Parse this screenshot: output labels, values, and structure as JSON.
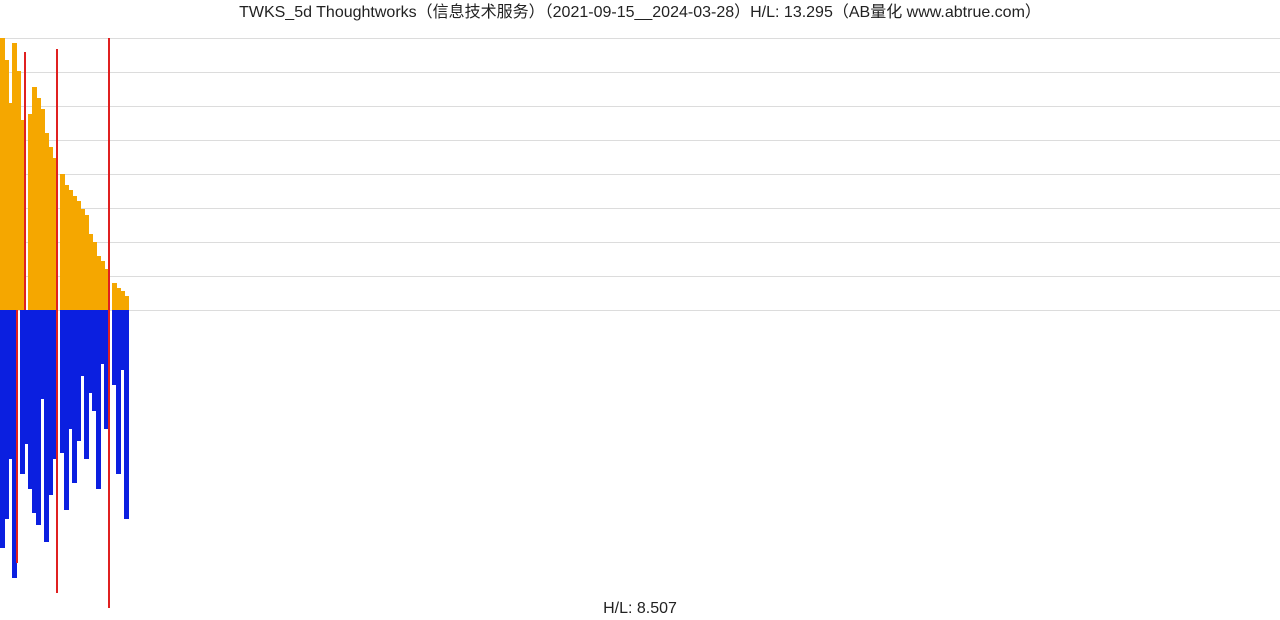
{
  "title": "TWKS_5d Thoughtworks（信息技术服务）（2021-09-15__2024-03-28）H/L: 13.295（AB量化  www.abtrue.com）",
  "footer": "H/L: 8.507",
  "chart_data": {
    "type": "bar",
    "layout": "two vertically stacked bar panels sharing the same x index",
    "x_extent_fraction": 0.1,
    "panels": [
      {
        "id": "top",
        "description": "orange bars rising from the midline upward; a few thin red bars interspersed",
        "color_main": "#f5a700",
        "color_accent": "#e02020",
        "grid": {
          "horizontal_lines": 9,
          "line_color": "#dcdcdc"
        },
        "ylim": [
          0,
          1
        ],
        "series": [
          {
            "name": "orange",
            "red_indices": [
              6,
              14,
              27
            ],
            "values": [
              1.0,
              0.92,
              0.76,
              0.98,
              0.88,
              0.7,
              0.95,
              0.72,
              0.82,
              0.78,
              0.74,
              0.65,
              0.6,
              0.56,
              0.96,
              0.5,
              0.46,
              0.44,
              0.42,
              0.4,
              0.37,
              0.35,
              0.28,
              0.25,
              0.2,
              0.18,
              0.15,
              1.0,
              0.1,
              0.08,
              0.07,
              0.05
            ]
          }
        ]
      },
      {
        "id": "bottom",
        "description": "blue bars hanging downward from the midline with varying lengths; a few thin red bars interspersed",
        "color_main": "#0b1fe0",
        "color_accent": "#e02020",
        "grid": {
          "horizontal_lines": 0
        },
        "ylim": [
          0,
          1
        ],
        "series": [
          {
            "name": "blue",
            "red_indices": [
              4,
              14,
              27
            ],
            "values": [
              0.8,
              0.7,
              0.5,
              0.9,
              0.85,
              0.55,
              0.45,
              0.6,
              0.68,
              0.72,
              0.3,
              0.78,
              0.62,
              0.5,
              0.95,
              0.48,
              0.67,
              0.4,
              0.58,
              0.44,
              0.22,
              0.5,
              0.28,
              0.34,
              0.6,
              0.18,
              0.4,
              1.0,
              0.25,
              0.55,
              0.2,
              0.7
            ]
          }
        ]
      }
    ]
  }
}
